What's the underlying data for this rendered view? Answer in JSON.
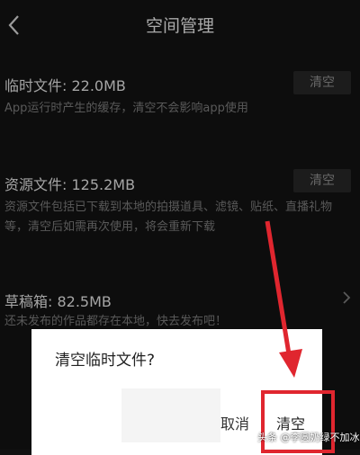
{
  "header": {
    "title": "空间管理"
  },
  "temp_files": {
    "title": "临时文件: 22.0MB",
    "desc": "App运行时产生的缓存，清空不会影响app使用",
    "button": "清空"
  },
  "resource_files": {
    "title": "资源文件: 125.2MB",
    "desc_line1": "资源文件包括已下载到本地的拍摄道具、滤镜、贴纸、直播礼物",
    "desc_line2": "等，清空后如需再次使用，将会重新下载",
    "button": "清空"
  },
  "drafts": {
    "title": "草稿箱: 82.5MB",
    "desc": "还未发布的作品都存在本地，快去发布吧！"
  },
  "dialog": {
    "title": "清空临时文件?",
    "cancel": "取消",
    "confirm": "清空"
  },
  "watermark": "头条 @李圆奶绿不加冰",
  "colors": {
    "highlight": "#e0262f",
    "background": "#121212"
  },
  "icons": [
    "back-icon",
    "chevron-right-icon",
    "annotation-arrow-icon"
  ]
}
